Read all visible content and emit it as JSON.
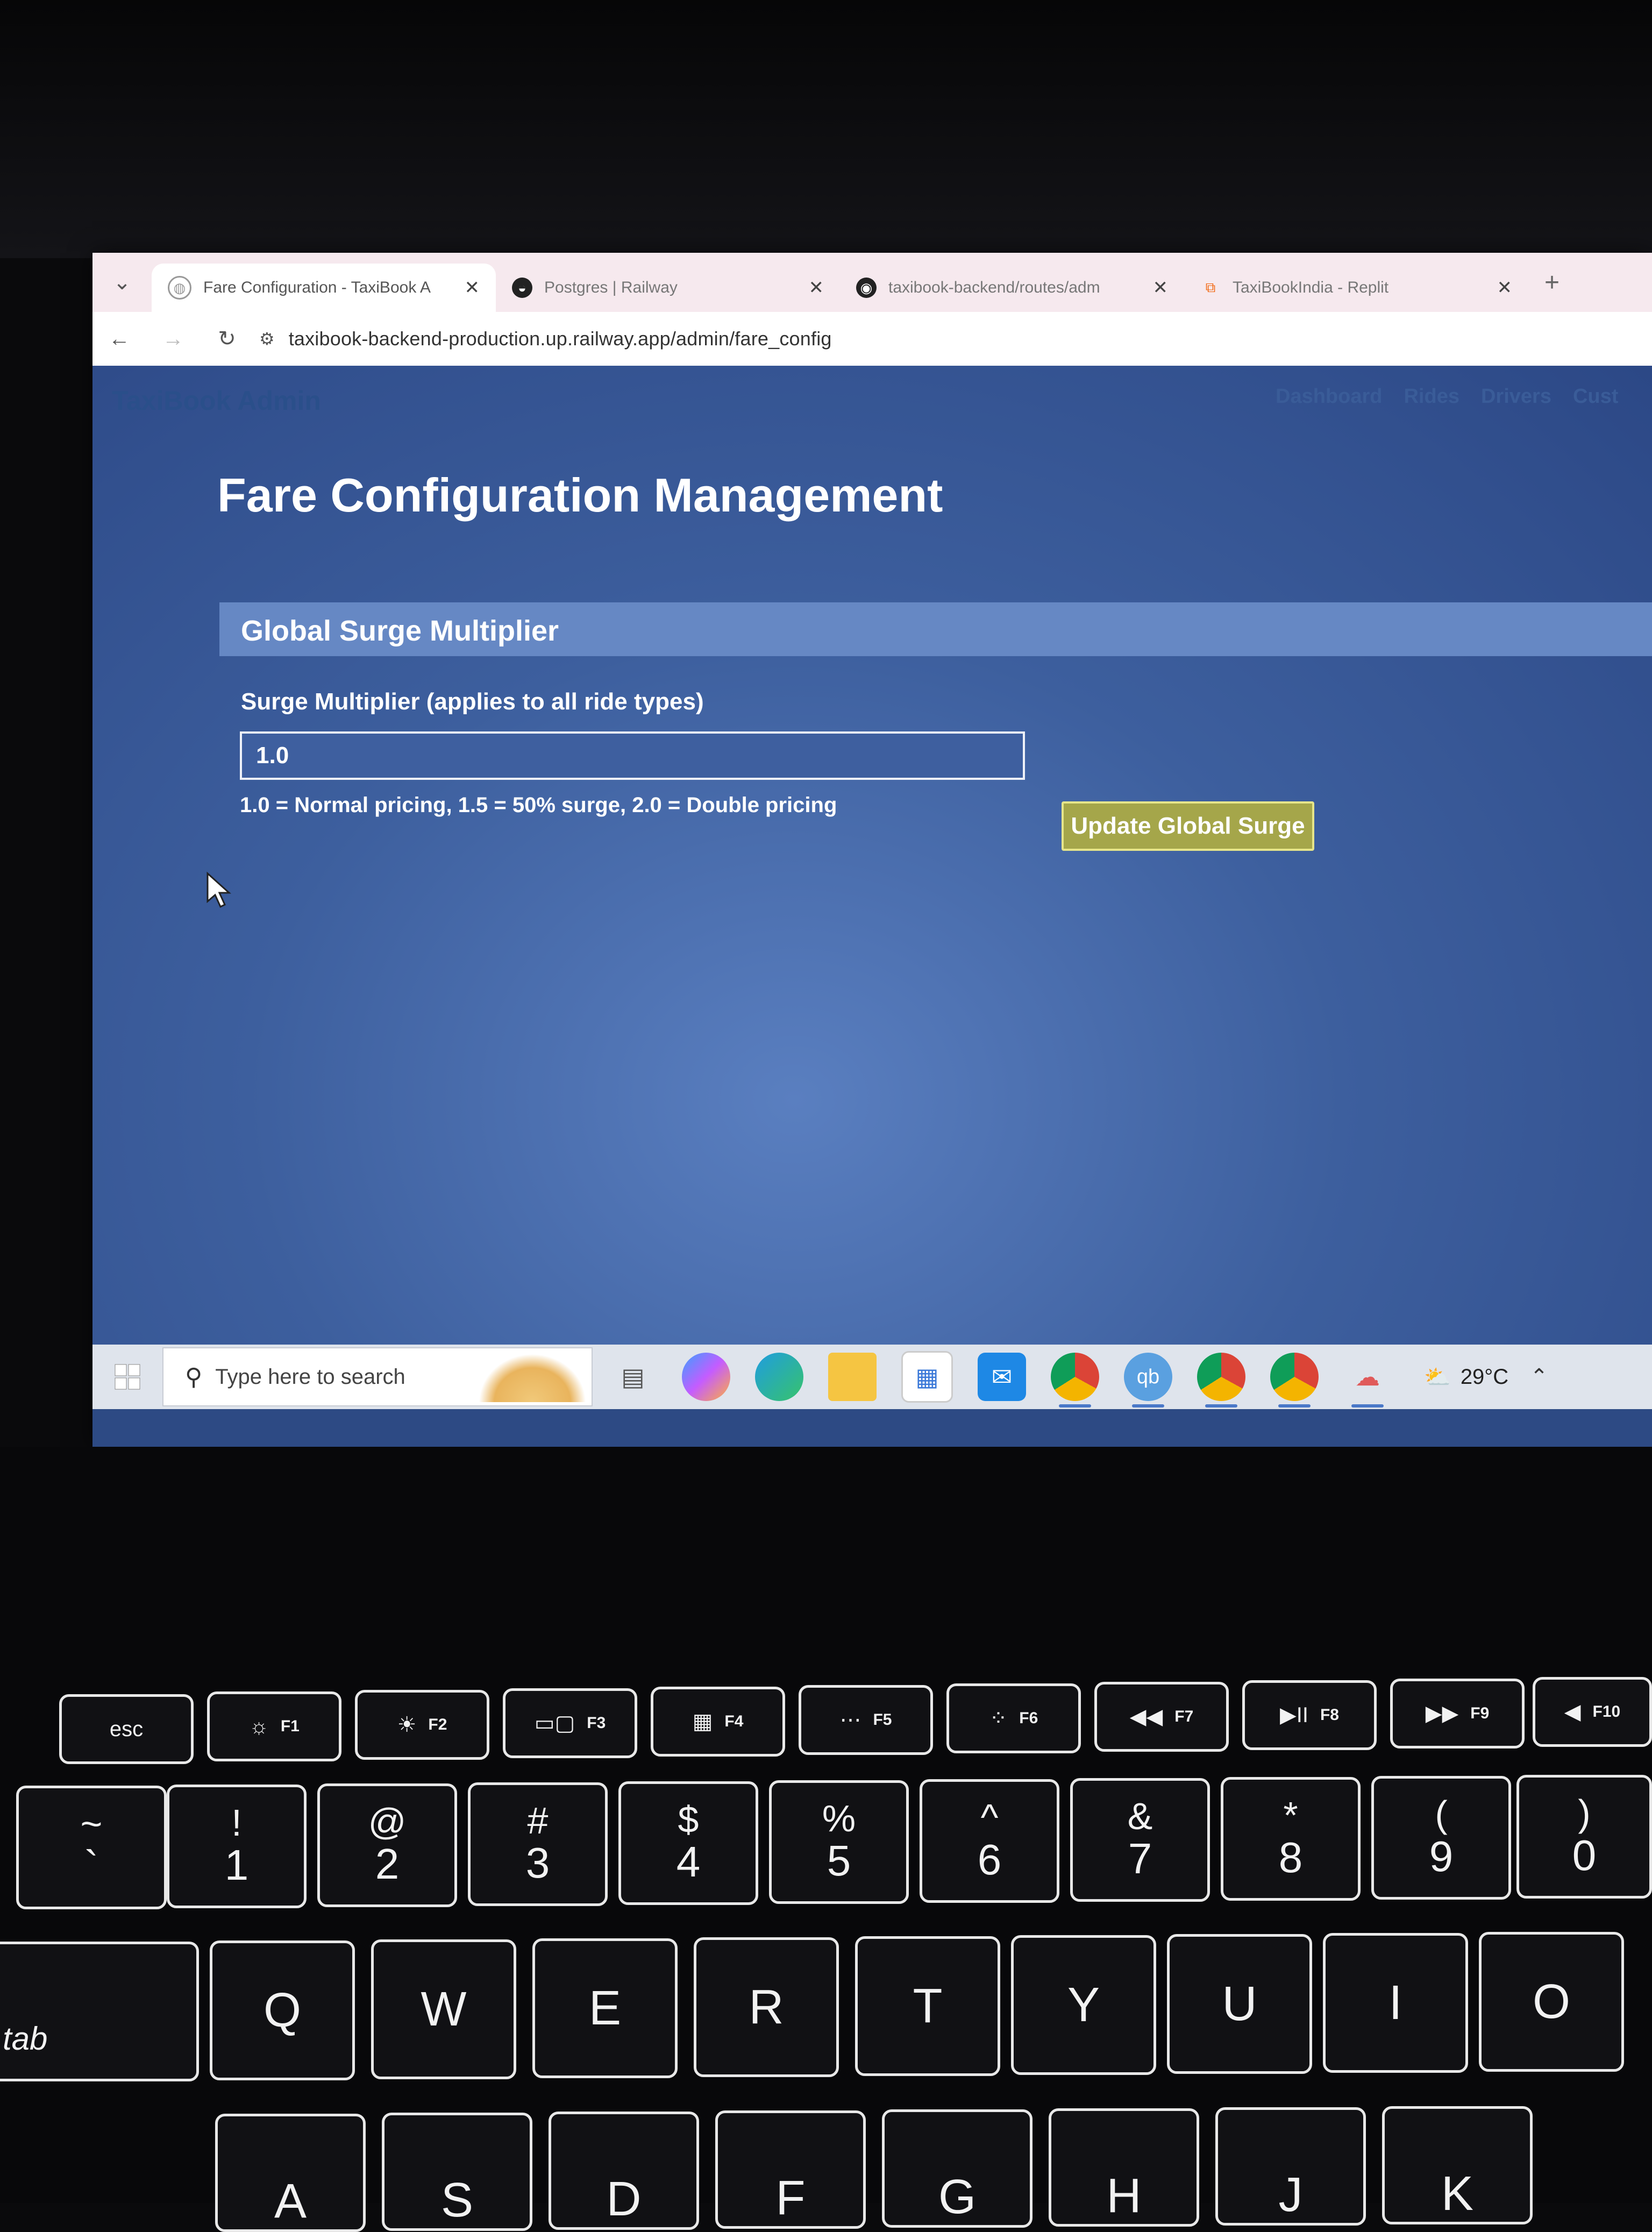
{
  "browser": {
    "tabs": [
      {
        "title": "Fare Configuration - TaxiBook A",
        "icon": "globe-icon",
        "active": true
      },
      {
        "title": "Postgres | Railway",
        "icon": "railway-icon",
        "active": false
      },
      {
        "title": "taxibook-backend/routes/adm",
        "icon": "github-icon",
        "active": false
      },
      {
        "title": "TaxiBookIndia - Replit",
        "icon": "replit-icon",
        "active": false
      }
    ],
    "url": "taxibook-backend-production.up.railway.app/admin/fare_config"
  },
  "admin": {
    "brand": "TaxiBook Admin",
    "nav": [
      "Dashboard",
      "Rides",
      "Drivers",
      "Cust"
    ]
  },
  "page": {
    "title": "Fare Configuration Management",
    "section_title": "Global Surge Multiplier",
    "field_label": "Surge Multiplier (applies to all ride types)",
    "input_value": "1.0",
    "hint": "1.0 = Normal pricing, 1.5 = 50% surge, 2.0 = Double pricing",
    "button_label": "Update Global Surge"
  },
  "taskbar": {
    "search_placeholder": "Type here to search",
    "temperature": "29°C",
    "icons": [
      "task-view-icon",
      "copilot-icon",
      "edge-icon",
      "file-explorer-icon",
      "store-icon",
      "mail-icon",
      "chrome-profile-icon",
      "qbittorrent-icon",
      "chrome-icon",
      "chrome-alt-icon",
      "cloud-app-icon"
    ]
  },
  "keyboard": {
    "fn_row": [
      {
        "label": "esc",
        "fn": ""
      },
      {
        "label": "☼",
        "fn": "F1"
      },
      {
        "label": "☀",
        "fn": "F2"
      },
      {
        "label": "▭▢",
        "fn": "F3"
      },
      {
        "label": "▦",
        "fn": "F4"
      },
      {
        "label": "⋯",
        "fn": "F5"
      },
      {
        "label": "⁘",
        "fn": "F6"
      },
      {
        "label": "◀◀",
        "fn": "F7"
      },
      {
        "label": "▶II",
        "fn": "F8"
      },
      {
        "label": "▶▶",
        "fn": "F9"
      },
      {
        "label": "◀",
        "fn": "F10"
      }
    ],
    "number_row": [
      {
        "top": "~",
        "bot": "`"
      },
      {
        "top": "!",
        "bot": "1"
      },
      {
        "top": "@",
        "bot": "2"
      },
      {
        "top": "#",
        "bot": "3"
      },
      {
        "top": "$",
        "bot": "4"
      },
      {
        "top": "%",
        "bot": "5"
      },
      {
        "top": "^",
        "bot": "6"
      },
      {
        "top": "&",
        "bot": "7"
      },
      {
        "top": "*",
        "bot": "8"
      },
      {
        "top": "(",
        "bot": "9"
      },
      {
        "top": ")",
        "bot": "0"
      }
    ],
    "qwerty_row": [
      "tab",
      "Q",
      "W",
      "E",
      "R",
      "T",
      "Y",
      "U",
      "I",
      "O"
    ],
    "home_row": [
      "A",
      "S",
      "D",
      "F",
      "G",
      "H",
      "J",
      "K"
    ]
  }
}
